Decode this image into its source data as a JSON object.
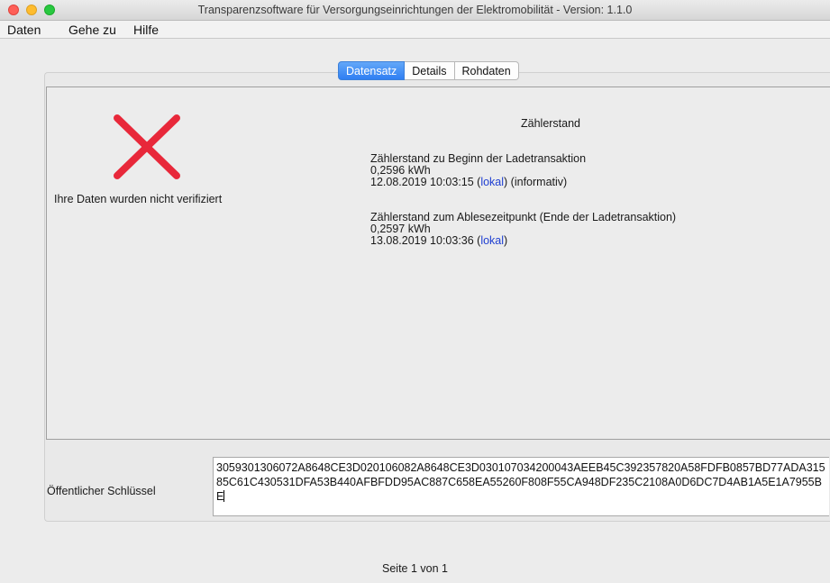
{
  "window": {
    "title": "Transparenzsoftware für Versorgungseinrichtungen der Elektromobilität - Version: 1.1.0"
  },
  "menu": [
    "Daten",
    "Gehe zu",
    "Hilfe"
  ],
  "tabs": [
    {
      "label": "Datensatz",
      "active": true
    },
    {
      "label": "Details",
      "active": false
    },
    {
      "label": "Rohdaten",
      "active": false
    }
  ],
  "verification": {
    "icon": "red-x-icon",
    "message": "Ihre Daten wurden nicht verifiziert"
  },
  "meter": {
    "title": "Zählerstand",
    "start": {
      "heading": "Zählerstand zu Beginn der Ladetransaktion",
      "value": "0,2596 kWh",
      "timestamp": "12.08.2019 10:03:15 (",
      "link": "lokal",
      "suffix": ") (informativ)"
    },
    "end": {
      "heading": "Zählerstand zum Ablesezeitpunkt (Ende der Ladetransaktion)",
      "value": "0,2597 kWh",
      "timestamp": "13.08.2019 10:03:36 (",
      "link": "lokal",
      "suffix": ")"
    }
  },
  "public_key": {
    "label": "Öffentlicher Schlüssel",
    "value": "3059301306072A8648CE3D020106082A8648CE3D030107034200043AEEB45C392357820A58FDFB0857BD77ADA31585C61C430531DFA53B440AFBFDD95AC887C658EA55260F808F55CA948DF235C2108A0D6DC7D4AB1A5E1A7955BE"
  },
  "pager": "Seite 1 von 1",
  "colors": {
    "tab_active": "#2f7ff3",
    "error_mark": "#e8283a",
    "link": "#1f3fd1"
  }
}
